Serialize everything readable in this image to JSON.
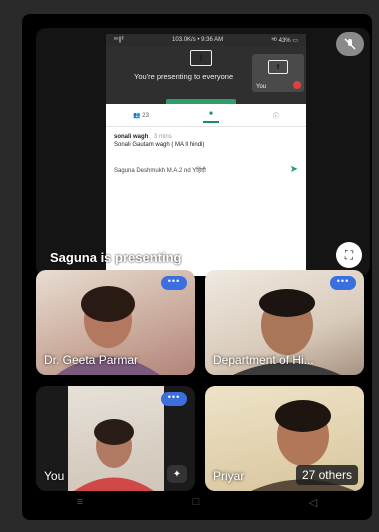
{
  "colors": {
    "accent_green": "#1a8f5e",
    "more_blue": "#3b6fe0",
    "rec_red": "#e04040"
  },
  "main_tile": {
    "presenting_label": "Saguna is presenting",
    "mute_icon": "mic-off-icon",
    "fullscreen_icon": "fullscreen-icon"
  },
  "phone": {
    "status_left": "ᵉᵉ||ˡˡ",
    "status_center": "103.0K/s • 9:36 AM",
    "status_right": "ᴴᴰ 43% ▭",
    "present_text": "You're presenting to everyone",
    "you_mini_label": "You",
    "tabs": {
      "people": "23",
      "chat_icon": "chat-icon",
      "info_icon": "info-icon"
    },
    "chat": {
      "sender": "sonali wagh",
      "time": "3 mins",
      "message": "Sonali  Gautam wagh ( MA ll hindi)"
    },
    "input_text": "Saguna Deshmukh M.A.2 nd Yहिंदी"
  },
  "tiles": [
    {
      "name": "Dr. Geeta Parmar"
    },
    {
      "name": "Department of Hi..."
    },
    {
      "name": "You"
    },
    {
      "name": "Priyar"
    }
  ],
  "others_badge": "27 others",
  "more_label": "•••",
  "navbar": {
    "recents": "≡",
    "home": "□",
    "back": "◁"
  }
}
